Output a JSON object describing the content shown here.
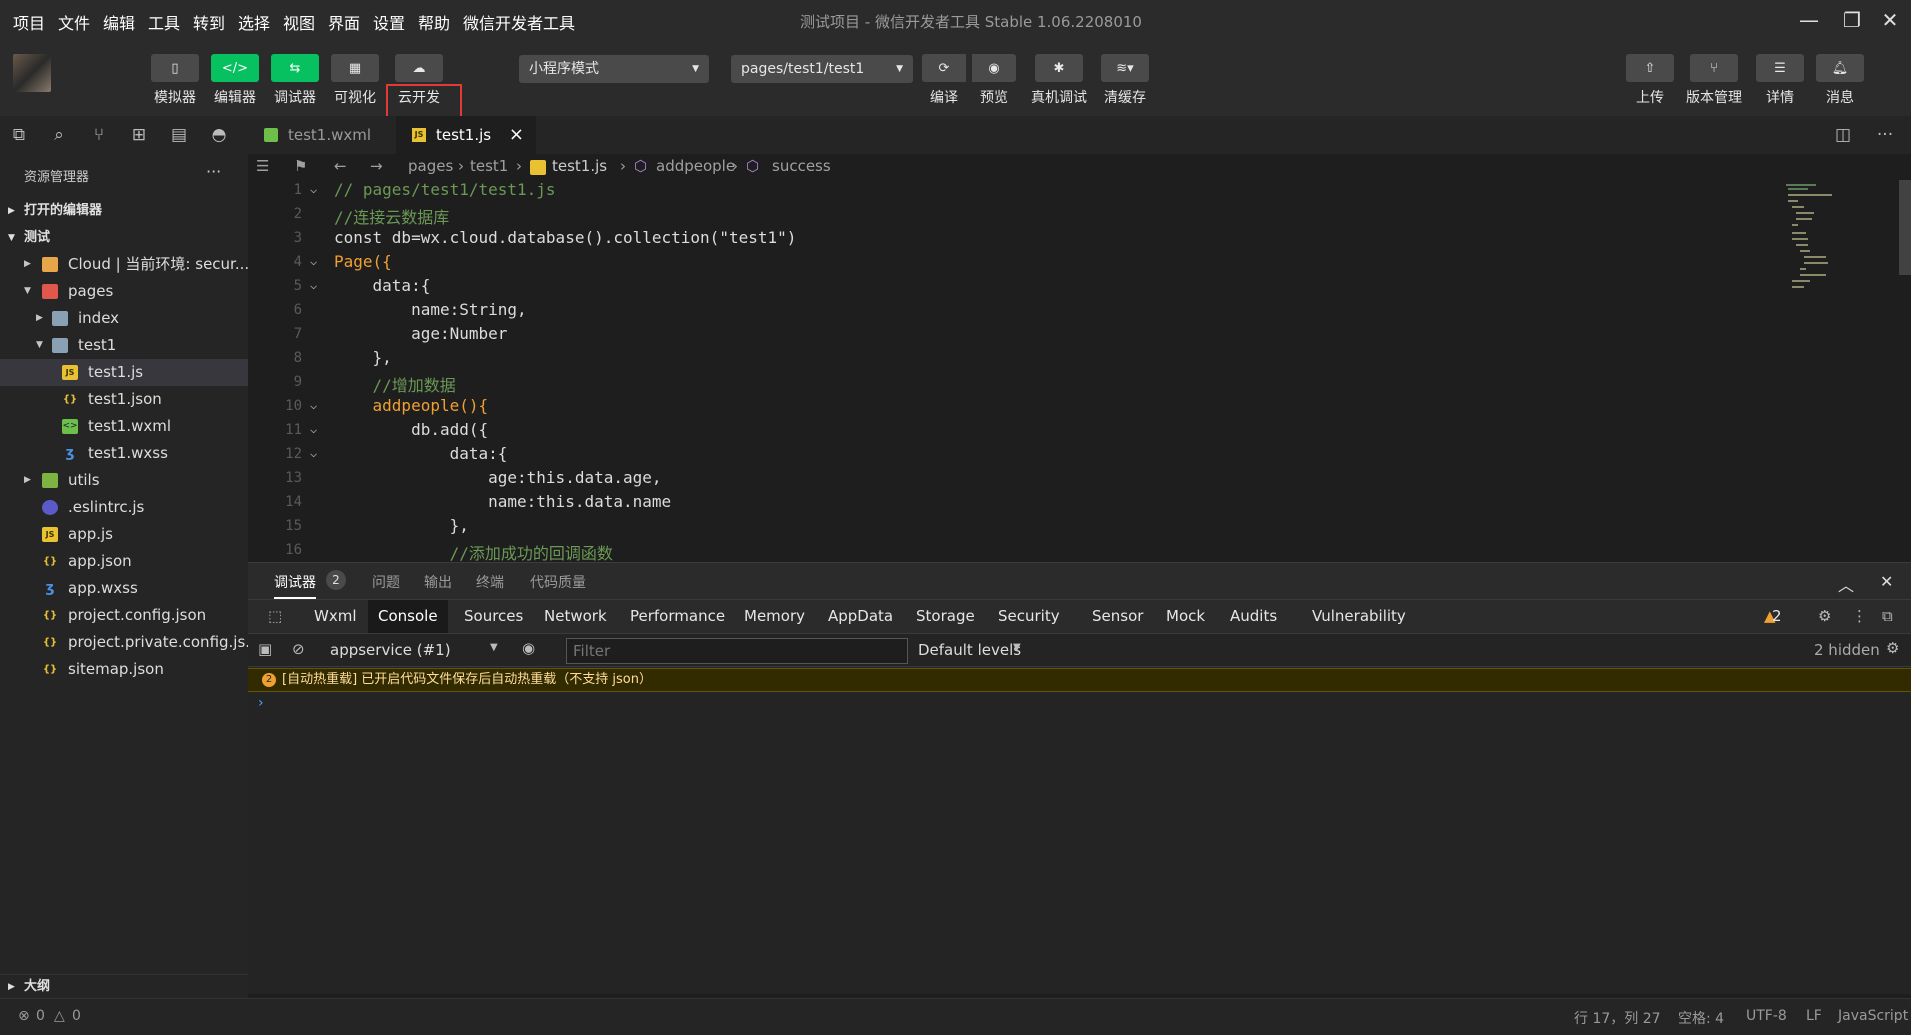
{
  "menubar": {
    "items": [
      "项目",
      "文件",
      "编辑",
      "工具",
      "转到",
      "选择",
      "视图",
      "界面",
      "设置",
      "帮助",
      "微信开发者工具"
    ],
    "title": "测试项目 - 微信开发者工具 Stable 1.06.2208010"
  },
  "toolbar": {
    "simulator": "模拟器",
    "editor": "编辑器",
    "debugger": "调试器",
    "visual": "可视化",
    "cloud": "云开发",
    "mode_select": "小程序模式",
    "page_select": "pages/test1/test1",
    "compile": "编译",
    "preview": "预览",
    "real_debug": "真机调试",
    "clear_cache": "清缓存",
    "upload": "上传",
    "version": "版本管理",
    "details": "详情",
    "messages": "消息"
  },
  "sidebar": {
    "header": "资源管理器",
    "open_editors": "打开的编辑器",
    "project": "测试",
    "outline": "大纲",
    "tree": [
      {
        "name": "Cloud | 当前环境: secur...",
        "type": "folder-cloud"
      },
      {
        "name": "pages",
        "type": "folder-pages"
      },
      {
        "name": "index",
        "type": "folder"
      },
      {
        "name": "test1",
        "type": "folder-open"
      },
      {
        "name": "test1.js",
        "type": "js"
      },
      {
        "name": "test1.json",
        "type": "json"
      },
      {
        "name": "test1.wxml",
        "type": "wxml"
      },
      {
        "name": "test1.wxss",
        "type": "wxss"
      },
      {
        "name": "utils",
        "type": "folder-utils"
      },
      {
        "name": ".eslintrc.js",
        "type": "eslint"
      },
      {
        "name": "app.js",
        "type": "js"
      },
      {
        "name": "app.json",
        "type": "json"
      },
      {
        "name": "app.wxss",
        "type": "wxss"
      },
      {
        "name": "project.config.json",
        "type": "json"
      },
      {
        "name": "project.private.config.js...",
        "type": "json"
      },
      {
        "name": "sitemap.json",
        "type": "json"
      }
    ]
  },
  "tabs": {
    "tab1": "test1.wxml",
    "tab2": "test1.js"
  },
  "breadcrumb": {
    "p1": "pages",
    "p2": "test1",
    "p3": "test1.js",
    "p4": "addpeople",
    "p5": "success"
  },
  "code": {
    "line_numbers": [
      "1",
      "2",
      "3",
      "4",
      "5",
      "6",
      "7",
      "8",
      "9",
      "10",
      "11",
      "12",
      "13",
      "14",
      "15",
      "16"
    ],
    "lines": [
      "// pages/test1/test1.js",
      "//连接云数据库",
      "const db=wx.cloud.database().collection(\"test1\")",
      "Page({",
      "    data:{",
      "        name:String,",
      "        age:Number",
      "    },",
      "    //增加数据",
      "    addpeople(){",
      "        db.add({",
      "            data:{",
      "                age:this.data.age,",
      "                name:this.data.name",
      "            },",
      "            //添加成功的回调函数"
    ]
  },
  "devtools": {
    "top_tabs": {
      "debugger": "调试器",
      "debugger_count": "2",
      "problems": "问题",
      "output": "输出",
      "terminal": "终端",
      "quality": "代码质量"
    },
    "tabs": [
      "Wxml",
      "Console",
      "Sources",
      "Network",
      "Performance",
      "Memory",
      "AppData",
      "Storage",
      "Security",
      "Sensor",
      "Mock",
      "Audits",
      "Vulnerability"
    ],
    "warn_count": "2",
    "context": "appservice (#1)",
    "filter_placeholder": "Filter",
    "levels": "Default levels",
    "hidden": "2 hidden",
    "warning_msg": "[自动热重载] 已开启代码文件保存后自动热重载（不支持 json）",
    "warning_badge": "2"
  },
  "status": {
    "errors": "0",
    "warnings": "0",
    "position": "行 17，列 27",
    "spaces": "空格: 4",
    "encoding": "UTF-8",
    "eol": "LF",
    "language": "JavaScript"
  },
  "colors": {
    "green_button": "#07c160",
    "highlight_border": "#e53935",
    "warning_bg": "#332b00"
  }
}
